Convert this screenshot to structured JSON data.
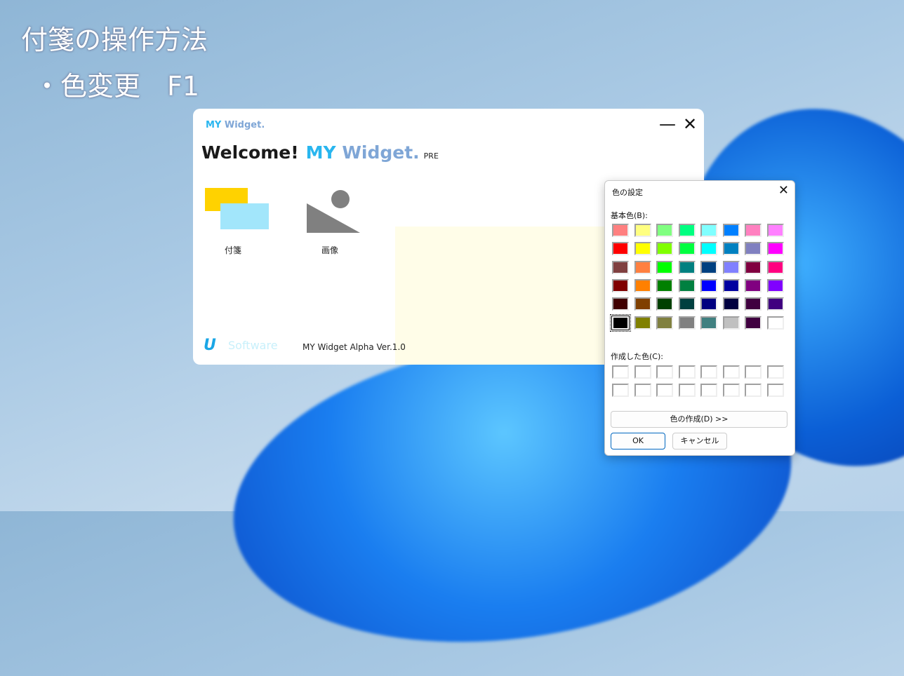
{
  "slide": {
    "title": "付箋の操作方法",
    "bullet": "・色変更　F1"
  },
  "app": {
    "logo_my": "MY",
    "logo_widget": "Widget.",
    "minimize": "—",
    "close": "✕",
    "welcome": "Welcome!",
    "brand_my": "MY",
    "brand_widget": "Widget.",
    "pre": "PRE",
    "tiles": [
      {
        "label": "付箋"
      },
      {
        "label": "画像"
      }
    ],
    "footer_logo": "U",
    "footer_software": "Software",
    "version": "MY Widget Alpha Ver.1.0"
  },
  "dialog": {
    "title": "色の設定",
    "close": "✕",
    "basic_label": "基本色(B):",
    "custom_label": "作成した色(C):",
    "define_button": "色の作成(D) >>",
    "ok": "OK",
    "cancel": "キャンセル",
    "basic_colors": [
      [
        "#FF8080",
        "#FFFF80",
        "#80FF80",
        "#00FF80",
        "#80FFFF",
        "#0080FF",
        "#FF80C0",
        "#FF80FF"
      ],
      [
        "#FF0000",
        "#FFFF00",
        "#80FF00",
        "#00FF40",
        "#00FFFF",
        "#0080C0",
        "#8080C0",
        "#FF00FF"
      ],
      [
        "#804040",
        "#FF8040",
        "#00FF00",
        "#008080",
        "#004080",
        "#8080FF",
        "#800040",
        "#FF0080"
      ],
      [
        "#800000",
        "#FF8000",
        "#008000",
        "#008040",
        "#0000FF",
        "#0000A0",
        "#800080",
        "#8000FF"
      ],
      [
        "#400000",
        "#804000",
        "#004000",
        "#004040",
        "#000080",
        "#000040",
        "#400040",
        "#400080"
      ],
      [
        "#000000",
        "#808000",
        "#808040",
        "#808080",
        "#408080",
        "#C0C0C0",
        "#400040",
        "#FFFFFF"
      ]
    ],
    "selected": "#000000",
    "custom_colors": [
      [
        "#FFFFFF",
        "#FFFFFF",
        "#FFFFFF",
        "#FFFFFF",
        "#FFFFFF",
        "#FFFFFF",
        "#FFFFFF",
        "#FFFFFF"
      ],
      [
        "#FFFFFF",
        "#FFFFFF",
        "#FFFFFF",
        "#FFFFFF",
        "#FFFFFF",
        "#FFFFFF",
        "#FFFFFF",
        "#FFFFFF"
      ]
    ]
  }
}
